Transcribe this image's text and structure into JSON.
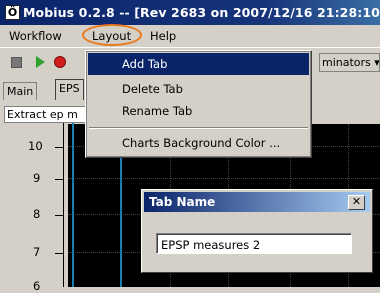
{
  "window": {
    "title": "Mobius 0.2.8 -- [Rev 2683 on 2007/12/16 21:28:10]",
    "app_icon_glyph": "Ö"
  },
  "menubar": {
    "items": [
      {
        "label": "Workflow"
      },
      {
        "label": "Layout"
      },
      {
        "label": "Help"
      }
    ]
  },
  "toolbar": {
    "discriminators_label": "minators ▾"
  },
  "tabs": [
    {
      "label": "Main"
    },
    {
      "label": "EPS"
    }
  ],
  "panel": {
    "header": "Extract ep m"
  },
  "chart": {
    "y_ticks": [
      "10",
      "9",
      "8",
      "7",
      "6"
    ]
  },
  "layout_menu": {
    "items": [
      {
        "label": "Add Tab",
        "highlighted": true
      },
      {
        "label": "Delete Tab"
      },
      {
        "label": "Rename Tab"
      },
      {
        "label": "Charts Background Color ..."
      }
    ]
  },
  "dialog": {
    "title": "Tab Name",
    "close_glyph": "✕",
    "input_value": "EPSP measures 2"
  },
  "colors": {
    "title_bar": "#0a246a",
    "menu_highlight": "#0a246a",
    "annotation_circle": "#e8791a",
    "chart_background": "#000000",
    "trace_line": "#1b7cb2"
  }
}
